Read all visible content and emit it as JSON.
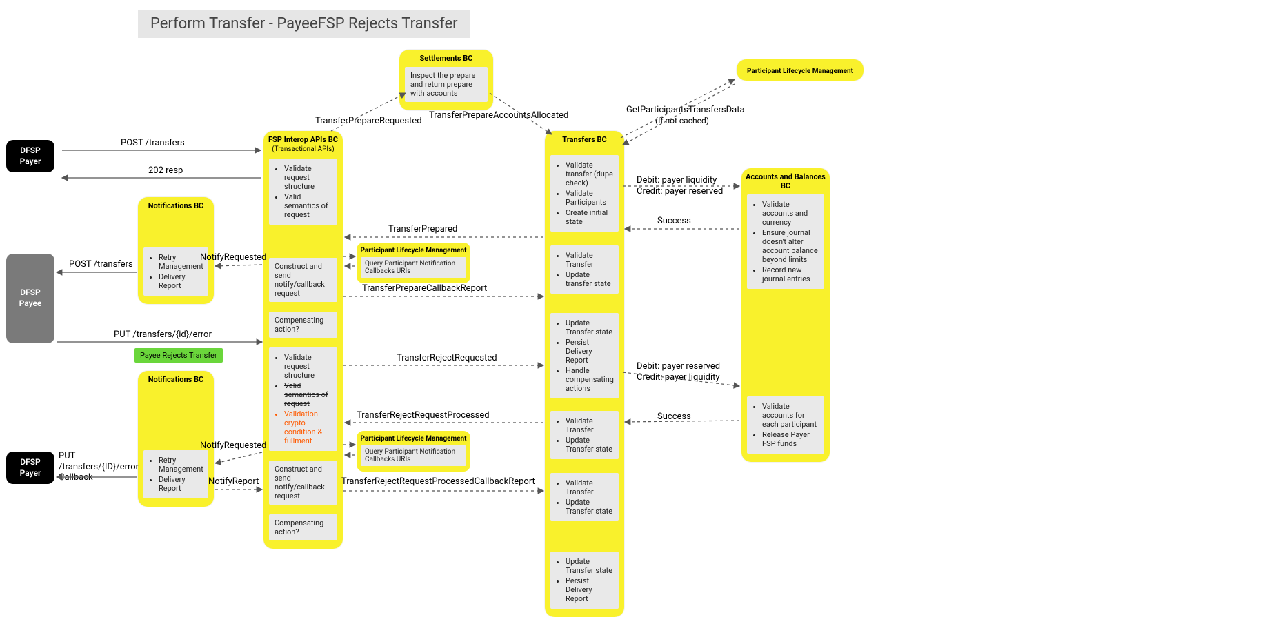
{
  "title": "Perform Transfer - PayeeFSP Rejects Transfer",
  "actors": {
    "payer1": {
      "l1": "DFSP",
      "l2": "Payer"
    },
    "payee": {
      "l1": "DFSP",
      "l2": "Payee"
    },
    "payer2": {
      "l1": "DFSP",
      "l2": "Payer"
    }
  },
  "fsp": {
    "title": "FSP Interop APIs BC",
    "sub": "(Transactional APIs)",
    "p1": [
      "Validate request structure",
      "Valid semantics of request"
    ],
    "p2": "Construct and send notify/callback request",
    "p3": "Compensating action?",
    "p4": {
      "a": "Validate request structure",
      "b": "Valid semantics of request",
      "c": "Validation crypto condition & fullment"
    },
    "p5": "Construct and send notify/callback request",
    "p6": "Compensating action?"
  },
  "notif1": {
    "title": "Notifications BC",
    "items": [
      "Retry Management",
      "Delivery Report"
    ]
  },
  "notif2": {
    "title": "Notifications BC",
    "items": [
      "Retry Management",
      "Delivery Report"
    ]
  },
  "settlements": {
    "title": "Settlements BC",
    "text": "Inspect the prepare and return prepare with accounts"
  },
  "plm_top": {
    "title": "Participant Lifecycle Management"
  },
  "plm1": {
    "title": "Participant Lifecycle Management",
    "text": "Query Participant Notification Callbacks URIs"
  },
  "plm2": {
    "title": "Participant Lifecycle Management",
    "text": "Query Participant Notification Callbacks URIs"
  },
  "transfers": {
    "title": "Transfers BC",
    "p1": [
      "Validate transfer (dupe check)",
      "Validate Participants",
      "Create initial state"
    ],
    "p2": [
      "Validate Transfer",
      "Update transfer state"
    ],
    "p3": [
      "Update Transfer state",
      "Persist Delivery Report",
      "Handle compensating actions"
    ],
    "p4": [
      "Validate Transfer",
      "Update Transfer state"
    ],
    "p5": [
      "Validate Transfer",
      "Update Transfer state"
    ],
    "p6": [
      "Update Transfer state",
      "Persist Delivery Report"
    ]
  },
  "accounts": {
    "title": "Accounts and Balances BC",
    "p1": [
      "Validate accounts and currency",
      "Ensure journal doesn't alter account balance beyond limits",
      "Record new journal entries"
    ],
    "p2": [
      "Validate accounts for each participant",
      "Release Payer FSP funds"
    ]
  },
  "edges": {
    "post_transfers1": "POST /transfers",
    "resp202": "202 resp",
    "prepare_requested": "TransferPrepareRequested",
    "accounts_allocated": "TransferPrepareAccountsAllocated",
    "prepared": "TransferPrepared",
    "get_part": "GetParticipantsTransfersData",
    "get_part_sub": "(If not cached)",
    "debit1": "Debit: payer liquidity",
    "credit1": "Credit: payer reserved",
    "success1": "Success",
    "notify_req1": "NotifyRequested",
    "post_transfers2": "POST /transfers",
    "put_err": "PUT /transfers/{id}/error",
    "payee_rejects": "Payee Rejects Transfer",
    "prepare_cb_report": "TransferPrepareCallbackReport",
    "reject_requested": "TransferRejectRequested",
    "reject_processed": "TransferRejectRequestProcessed",
    "debit2": "Debit: payer reserved",
    "credit2": "Credit: payer liquidity",
    "success2": "Success",
    "notify_req2": "NotifyRequested",
    "notify_report": "NotifyReport",
    "put_cb": "PUT /transfers/{ID}/error Callback",
    "reject_cb_report": "TransferRejectRequestProcessedCallbackReport"
  }
}
